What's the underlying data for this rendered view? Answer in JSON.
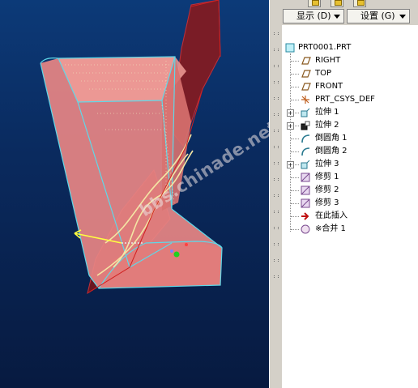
{
  "watermark": "bbs.chinade.net",
  "toolbar": {
    "show_label": "显示 (D)",
    "settings_label": "设置 (G)"
  },
  "tree": {
    "root": "PRT0001.PRT",
    "items": [
      {
        "label": "RIGHT",
        "icon": "datum-plane-icon",
        "expandable": false
      },
      {
        "label": "TOP",
        "icon": "datum-plane-icon",
        "expandable": false
      },
      {
        "label": "FRONT",
        "icon": "datum-plane-icon",
        "expandable": false
      },
      {
        "label": "PRT_CSYS_DEF",
        "icon": "coordinate-system-icon",
        "expandable": false
      },
      {
        "label": "拉伸 1",
        "icon": "extrude-icon",
        "expandable": true
      },
      {
        "label": "拉伸 2",
        "icon": "extrude-cut-icon",
        "expandable": true
      },
      {
        "label": "倒圆角 1",
        "icon": "round-icon",
        "expandable": false
      },
      {
        "label": "倒圆角 2",
        "icon": "round-icon",
        "expandable": false
      },
      {
        "label": "拉伸 3",
        "icon": "extrude-icon",
        "expandable": true
      },
      {
        "label": "修剪 1",
        "icon": "trim-icon",
        "expandable": false
      },
      {
        "label": "修剪 2",
        "icon": "trim-icon",
        "expandable": false
      },
      {
        "label": "修剪 3",
        "icon": "trim-icon",
        "expandable": false
      },
      {
        "label": "在此插入",
        "icon": "insert-here-arrow-icon",
        "expandable": false
      },
      {
        "label": "※合并 1",
        "icon": "merge-icon",
        "expandable": false
      }
    ]
  },
  "colors": {
    "viewport_top": "#0c3a78",
    "model_face": "#e07a78",
    "model_edge": "#5fd8e8",
    "curve": "#f0e4a0",
    "panel_bg": "#ffffff"
  }
}
